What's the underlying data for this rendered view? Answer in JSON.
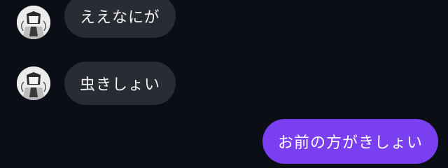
{
  "messages": [
    {
      "direction": "incoming",
      "text": "ええなにが"
    },
    {
      "direction": "incoming",
      "text": "虫きしょい"
    },
    {
      "direction": "outgoing",
      "text": "お前の方がきしょい"
    }
  ],
  "colors": {
    "background": "#0b0e14",
    "incoming_bubble": "#2a2c33",
    "outgoing_bubble": "#7b3ff2"
  },
  "icons": {
    "avatar": "user-avatar-icon"
  }
}
